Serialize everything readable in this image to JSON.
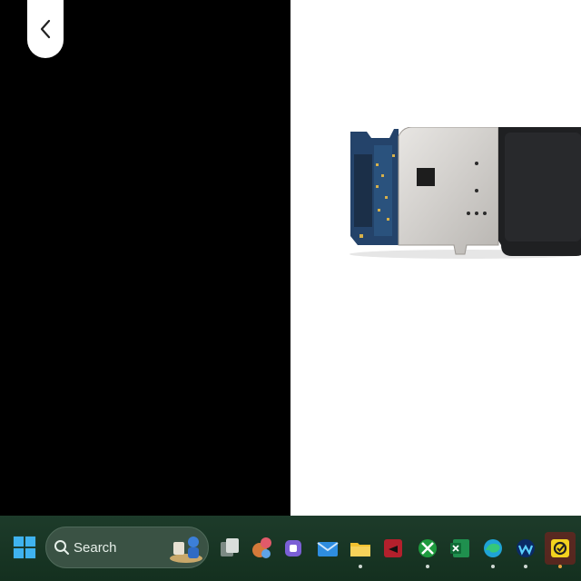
{
  "viewer": {
    "back_icon": "chevron-left-icon",
    "image_alt": "circuit-board"
  },
  "taskbar": {
    "search_placeholder": "Search",
    "icons": [
      "windows-start-icon",
      "task-view-icon",
      "copilot-people-icon",
      "teams-icon",
      "mail-icon",
      "file-explorer-icon",
      "app-red-icon",
      "xbox-icon",
      "excel-icon",
      "edge-icon",
      "webex-icon",
      "norton-icon"
    ],
    "running": [
      "file-explorer-icon",
      "xbox-icon",
      "edge-icon",
      "webex-icon",
      "norton-icon"
    ],
    "accent": "#1d3b2a"
  }
}
